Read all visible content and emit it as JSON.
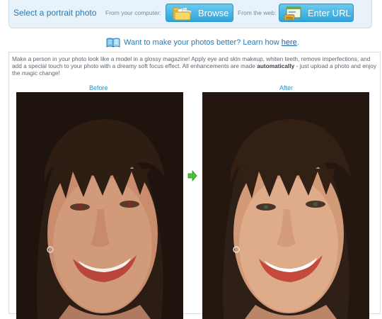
{
  "upload": {
    "title": "Select a portrait photo",
    "computer_label": "From your computer:",
    "browse_label": "Browse",
    "web_label": "From the web:",
    "url_label": "Enter URL"
  },
  "learn": {
    "text": "Want to make your photos better? Learn how ",
    "link": "here",
    "end": "."
  },
  "panel": {
    "desc_1": "Make a person in your photo look like a model in a glossy magazine! Apply eye and skin makeup, whiten teeth, remove imperfections, and add a special touch to your photo with a dreamy soft focus effect. All enhancements are made ",
    "desc_bold": "automatically",
    "desc_2": " - just upload a photo and enjoy the magic change!",
    "before_label": "Before",
    "after_label": "After"
  },
  "colors": {
    "accent": "#2a7ab4",
    "button": "#2ea4da",
    "arrow": "#46c23a"
  },
  "icons": {
    "browse": "folder-icon",
    "url": "web-link-icon",
    "learn": "open-book-icon",
    "arrow": "right-arrow-icon"
  }
}
